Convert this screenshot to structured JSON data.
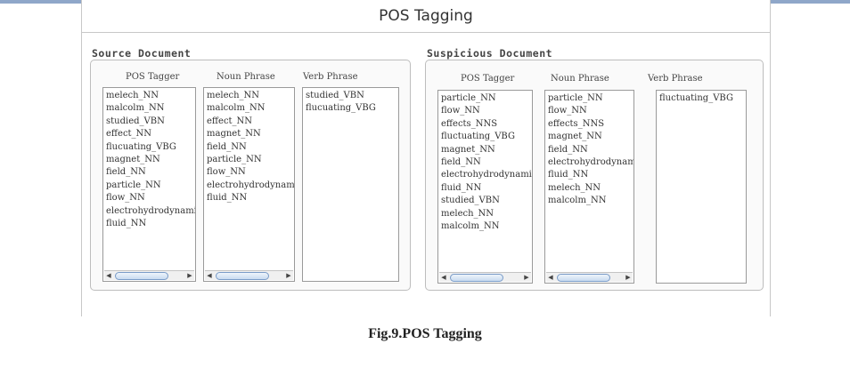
{
  "window": {
    "title": "POS Tagging"
  },
  "source": {
    "label": "Source Document",
    "columns": [
      {
        "header": "POS Tagger",
        "items": [
          "melech_NN",
          "malcolm_NN",
          "studied_VBN",
          "effect_NN",
          "flucuating_VBG",
          "magnet_NN",
          "field_NN",
          "particle_NN",
          "flow_NN",
          "electrohydrodynamics_NNS",
          "fluid_NN"
        ]
      },
      {
        "header": "Noun Phrase",
        "items": [
          "melech_NN",
          "malcolm_NN",
          "effect_NN",
          "magnet_NN",
          "field_NN",
          "particle_NN",
          "flow_NN",
          "electrohydrodynamics_NNS",
          "fluid_NN"
        ]
      },
      {
        "header": "Verb Phrase",
        "items": [
          "studied_VBN",
          "flucuating_VBG"
        ]
      }
    ]
  },
  "suspicious": {
    "label": "Suspicious Document",
    "columns": [
      {
        "header": "POS Tagger",
        "items": [
          "particle_NN",
          "flow_NN",
          "effects_NNS",
          "fluctuating_VBG",
          "magnet_NN",
          "field_NN",
          "electrohydrodynamics_NNS",
          "fluid_NN",
          "studied_VBN",
          "melech_NN",
          "malcolm_NN"
        ]
      },
      {
        "header": "Noun Phrase",
        "items": [
          "particle_NN",
          "flow_NN",
          "effects_NNS",
          "magnet_NN",
          "field_NN",
          "electrohydrodynamics_NNS",
          "fluid_NN",
          "melech_NN",
          "malcolm_NN"
        ]
      },
      {
        "header": "Verb Phrase",
        "items": [
          "fluctuating_VBG"
        ]
      }
    ]
  },
  "caption": "Fig.9.POS Tagging"
}
